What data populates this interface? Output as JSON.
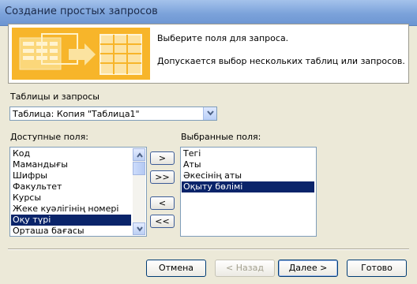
{
  "window": {
    "title": "Создание простых запросов"
  },
  "header": {
    "instruction": "Выберите поля для запроса.",
    "note": "Допускается выбор нескольких таблиц или запросов."
  },
  "source": {
    "label": "Таблицы и запросы",
    "selected": "Таблица: Копия \"Таблица1\""
  },
  "available": {
    "label": "Доступные поля:",
    "items": [
      "Код",
      "Мамандығы",
      "Шифры",
      "Факультет",
      "Курсы",
      "Жеке куәлігінің номері",
      "Оқу түрі",
      "Орташа бағасы"
    ],
    "selected_index": 6
  },
  "chosen": {
    "label": "Выбранные поля:",
    "items": [
      "Тегі",
      "Аты",
      "Әкесінің аты",
      "Оқыту бөлімі"
    ],
    "selected_index": 3
  },
  "move_buttons": {
    "add_one": ">",
    "add_all": ">>",
    "remove_one": "<",
    "remove_all": "<<"
  },
  "footer": {
    "cancel": "Отмена",
    "back": "< Назад",
    "next": "Далее >",
    "finish": "Готово"
  },
  "colors": {
    "selection": "#0a246a",
    "header_image": "#f7b52a",
    "titlebar": "#7ba2da"
  }
}
